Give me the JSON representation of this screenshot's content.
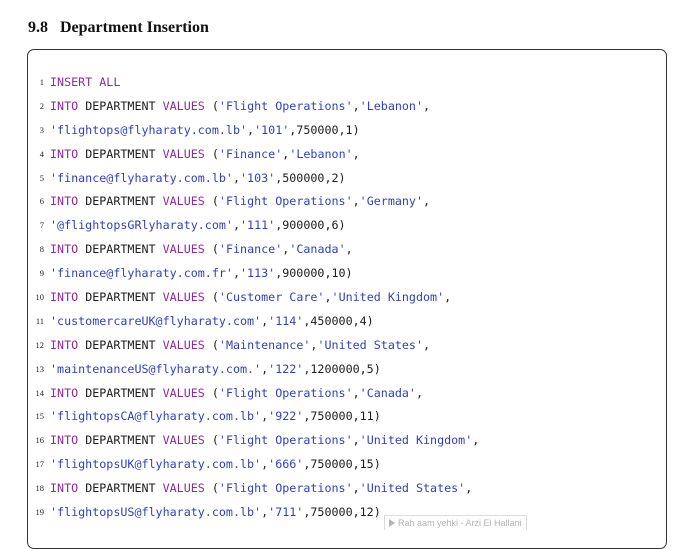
{
  "section": {
    "number": "9.8",
    "title": "Department Insertion"
  },
  "code": {
    "lines": [
      {
        "no": "1",
        "tokens": [
          {
            "t": "kw",
            "v": "INSERT ALL"
          }
        ]
      },
      {
        "no": "2",
        "tokens": [
          {
            "t": "kw",
            "v": "INTO"
          },
          {
            "t": "plain",
            "v": " DEPARTMENT "
          },
          {
            "t": "kw",
            "v": "VALUES"
          },
          {
            "t": "plain",
            "v": " ("
          },
          {
            "t": "str",
            "v": "'Flight Operations'"
          },
          {
            "t": "plain",
            "v": ","
          },
          {
            "t": "str",
            "v": "'Lebanon'"
          },
          {
            "t": "plain",
            "v": ","
          }
        ]
      },
      {
        "no": "3",
        "tokens": [
          {
            "t": "str",
            "v": "'flightops@flyharaty.com.lb'"
          },
          {
            "t": "plain",
            "v": ","
          },
          {
            "t": "str",
            "v": "'101'"
          },
          {
            "t": "plain",
            "v": ",750000,1)"
          }
        ]
      },
      {
        "no": "4",
        "tokens": [
          {
            "t": "kw",
            "v": "INTO"
          },
          {
            "t": "plain",
            "v": " DEPARTMENT "
          },
          {
            "t": "kw",
            "v": "VALUES"
          },
          {
            "t": "plain",
            "v": " ("
          },
          {
            "t": "str",
            "v": "'Finance'"
          },
          {
            "t": "plain",
            "v": ","
          },
          {
            "t": "str",
            "v": "'Lebanon'"
          },
          {
            "t": "plain",
            "v": ","
          }
        ]
      },
      {
        "no": "5",
        "tokens": [
          {
            "t": "str",
            "v": "'finance@flyharaty.com.lb'"
          },
          {
            "t": "plain",
            "v": ","
          },
          {
            "t": "str",
            "v": "'103'"
          },
          {
            "t": "plain",
            "v": ",500000,2)"
          }
        ]
      },
      {
        "no": "6",
        "tokens": [
          {
            "t": "kw",
            "v": "INTO"
          },
          {
            "t": "plain",
            "v": " DEPARTMENT "
          },
          {
            "t": "kw",
            "v": "VALUES"
          },
          {
            "t": "plain",
            "v": " ("
          },
          {
            "t": "str",
            "v": "'Flight Operations'"
          },
          {
            "t": "plain",
            "v": ","
          },
          {
            "t": "str",
            "v": "'Germany'"
          },
          {
            "t": "plain",
            "v": ","
          }
        ]
      },
      {
        "no": "7",
        "tokens": [
          {
            "t": "str",
            "v": "'@flightopsGRlyharaty.com'"
          },
          {
            "t": "plain",
            "v": ","
          },
          {
            "t": "str",
            "v": "'111'"
          },
          {
            "t": "plain",
            "v": ",900000,6)"
          }
        ]
      },
      {
        "no": "8",
        "tokens": [
          {
            "t": "kw",
            "v": "INTO"
          },
          {
            "t": "plain",
            "v": " DEPARTMENT "
          },
          {
            "t": "kw",
            "v": "VALUES"
          },
          {
            "t": "plain",
            "v": " ("
          },
          {
            "t": "str",
            "v": "'Finance'"
          },
          {
            "t": "plain",
            "v": ","
          },
          {
            "t": "str",
            "v": "'Canada'"
          },
          {
            "t": "plain",
            "v": ","
          }
        ]
      },
      {
        "no": "9",
        "tokens": [
          {
            "t": "str",
            "v": "'finance@flyharaty.com.fr'"
          },
          {
            "t": "plain",
            "v": ","
          },
          {
            "t": "str",
            "v": "'113'"
          },
          {
            "t": "plain",
            "v": ",900000,10)"
          }
        ]
      },
      {
        "no": "10",
        "tokens": [
          {
            "t": "kw",
            "v": "INTO"
          },
          {
            "t": "plain",
            "v": " DEPARTMENT "
          },
          {
            "t": "kw",
            "v": "VALUES"
          },
          {
            "t": "plain",
            "v": " ("
          },
          {
            "t": "str",
            "v": "'Customer Care'"
          },
          {
            "t": "plain",
            "v": ","
          },
          {
            "t": "str",
            "v": "'United Kingdom'"
          },
          {
            "t": "plain",
            "v": ","
          }
        ]
      },
      {
        "no": "11",
        "tokens": [
          {
            "t": "str",
            "v": "'customercareUK@flyharaty.com'"
          },
          {
            "t": "plain",
            "v": ","
          },
          {
            "t": "str",
            "v": "'114'"
          },
          {
            "t": "plain",
            "v": ",450000,4)"
          }
        ]
      },
      {
        "no": "12",
        "tokens": [
          {
            "t": "kw",
            "v": "INTO"
          },
          {
            "t": "plain",
            "v": " DEPARTMENT "
          },
          {
            "t": "kw",
            "v": "VALUES"
          },
          {
            "t": "plain",
            "v": " ("
          },
          {
            "t": "str",
            "v": "'Maintenance'"
          },
          {
            "t": "plain",
            "v": ","
          },
          {
            "t": "str",
            "v": "'United States'"
          },
          {
            "t": "plain",
            "v": ","
          }
        ]
      },
      {
        "no": "13",
        "tokens": [
          {
            "t": "str",
            "v": "'maintenanceUS@flyharaty.com.'"
          },
          {
            "t": "plain",
            "v": ","
          },
          {
            "t": "str",
            "v": "'122'"
          },
          {
            "t": "plain",
            "v": ",1200000,5)"
          }
        ]
      },
      {
        "no": "14",
        "tokens": [
          {
            "t": "kw",
            "v": "INTO"
          },
          {
            "t": "plain",
            "v": " DEPARTMENT "
          },
          {
            "t": "kw",
            "v": "VALUES"
          },
          {
            "t": "plain",
            "v": " ("
          },
          {
            "t": "str",
            "v": "'Flight Operations'"
          },
          {
            "t": "plain",
            "v": ","
          },
          {
            "t": "str",
            "v": "'Canada'"
          },
          {
            "t": "plain",
            "v": ","
          }
        ]
      },
      {
        "no": "15",
        "tokens": [
          {
            "t": "str",
            "v": "'flightopsCA@flyharaty.com.lb'"
          },
          {
            "t": "plain",
            "v": ","
          },
          {
            "t": "str",
            "v": "'922'"
          },
          {
            "t": "plain",
            "v": ",750000,11)"
          }
        ]
      },
      {
        "no": "16",
        "tokens": [
          {
            "t": "kw",
            "v": "INTO"
          },
          {
            "t": "plain",
            "v": " DEPARTMENT "
          },
          {
            "t": "kw",
            "v": "VALUES"
          },
          {
            "t": "plain",
            "v": " ("
          },
          {
            "t": "str",
            "v": "'Flight Operations'"
          },
          {
            "t": "plain",
            "v": ","
          },
          {
            "t": "str",
            "v": "'United Kingdom'"
          },
          {
            "t": "plain",
            "v": ","
          }
        ]
      },
      {
        "no": "17",
        "tokens": [
          {
            "t": "str",
            "v": "'flightopsUK@flyharaty.com.lb'"
          },
          {
            "t": "plain",
            "v": ","
          },
          {
            "t": "str",
            "v": "'666'"
          },
          {
            "t": "plain",
            "v": ",750000,15)"
          }
        ]
      },
      {
        "no": "18",
        "tokens": [
          {
            "t": "kw",
            "v": "INTO"
          },
          {
            "t": "plain",
            "v": " DEPARTMENT "
          },
          {
            "t": "kw",
            "v": "VALUES"
          },
          {
            "t": "plain",
            "v": " ("
          },
          {
            "t": "str",
            "v": "'Flight Operations'"
          },
          {
            "t": "plain",
            "v": ","
          },
          {
            "t": "str",
            "v": "'United States'"
          },
          {
            "t": "plain",
            "v": ","
          }
        ]
      },
      {
        "no": "19",
        "tokens": [
          {
            "t": "str",
            "v": "'flightopsUS@flyharaty.com.lb'"
          },
          {
            "t": "plain",
            "v": ","
          },
          {
            "t": "str",
            "v": "'711'"
          },
          {
            "t": "plain",
            "v": ",750000,12)"
          }
        ]
      }
    ]
  },
  "overlay": {
    "caption": "Rah aam yehki - Arzi El Hallani"
  },
  "colors": {
    "keyword": "#8e2a9b",
    "string": "#2f3fc0",
    "plain": "#1c1c1c",
    "border": "#333333"
  }
}
